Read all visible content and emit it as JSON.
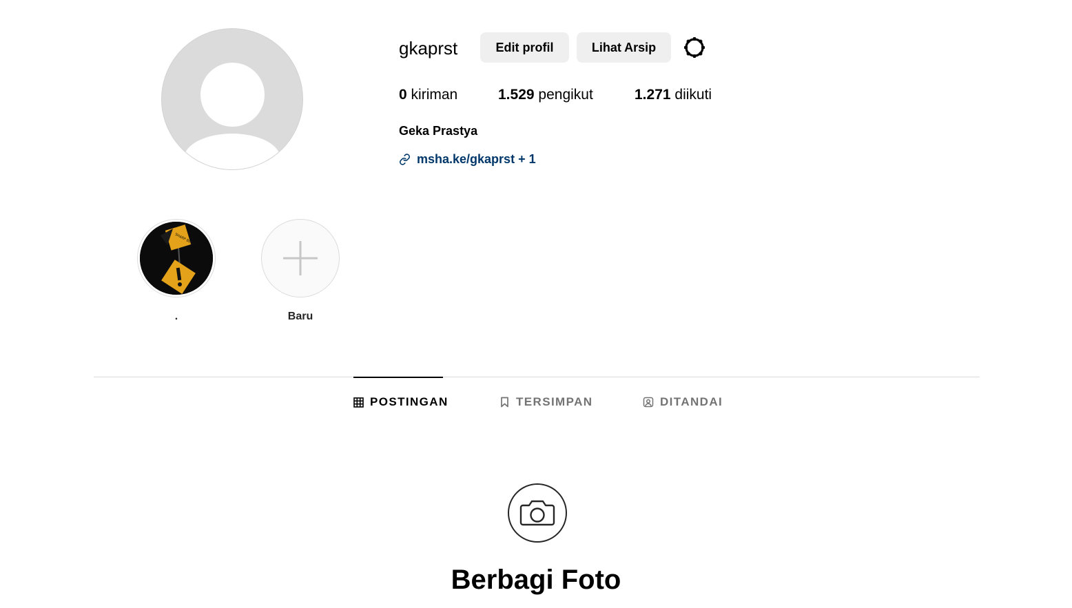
{
  "profile": {
    "username": "gkaprst",
    "full_name": "Geka Prastya",
    "link": "msha.ke/gkaprst + 1",
    "avatar_icon": "default-avatar-icon"
  },
  "header": {
    "edit_label": "Edit profil",
    "archive_label": "Lihat Arsip",
    "settings_icon": "gear-icon"
  },
  "stats": {
    "posts_count": "0",
    "posts_label": "kiriman",
    "followers_count": "1.529",
    "followers_label": "pengikut",
    "following_count": "1.271",
    "following_label": "diikuti"
  },
  "highlights": [
    {
      "label": ".",
      "icon": "warning-signs-image"
    },
    {
      "label": "Baru",
      "icon": "plus-icon"
    }
  ],
  "tabs": [
    {
      "label": "POSTINGAN",
      "icon": "grid-icon",
      "active": true
    },
    {
      "label": "TERSIMPAN",
      "icon": "bookmark-icon",
      "active": false
    },
    {
      "label": "DITANDAI",
      "icon": "tagged-user-icon",
      "active": false
    }
  ],
  "empty_state": {
    "title": "Berbagi Foto",
    "icon": "camera-icon"
  },
  "colors": {
    "link": "#00376b",
    "button_bg": "#efefef",
    "divider": "#dbdbdb",
    "inactive_tab": "#737373"
  }
}
